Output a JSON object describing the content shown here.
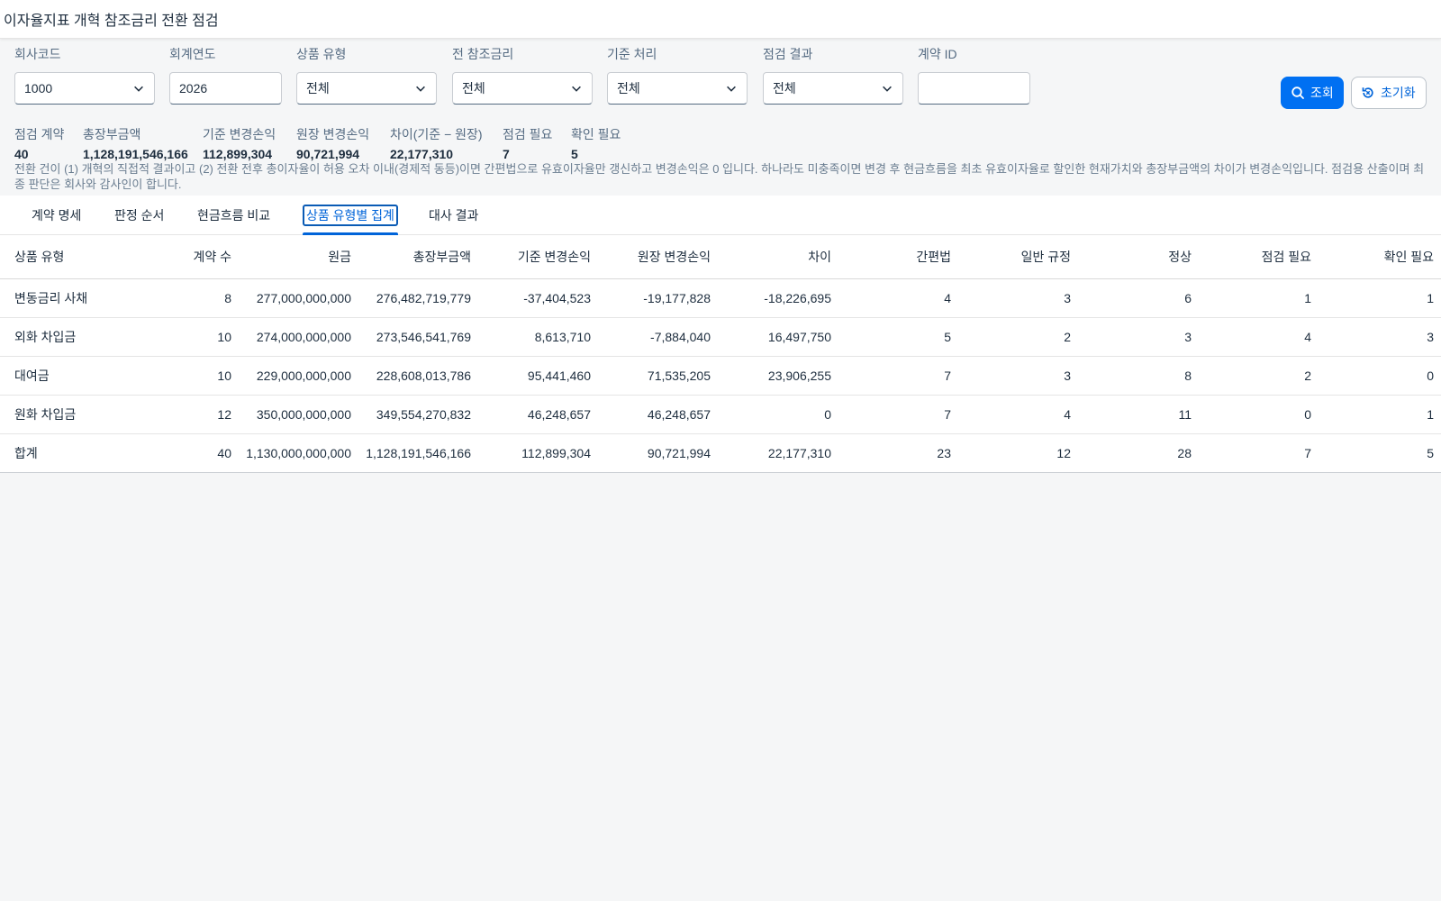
{
  "app": {
    "title": "이자율지표 개혁 참조금리 전환 점검"
  },
  "filters": {
    "company": {
      "label": "회사코드",
      "value": "1000"
    },
    "year": {
      "label": "회계연도",
      "value": "2026"
    },
    "product": {
      "label": "상품 유형",
      "value": "전체"
    },
    "prev_rate": {
      "label": "전 참조금리",
      "value": "전체"
    },
    "basis": {
      "label": "기준 처리",
      "value": "전체"
    },
    "result": {
      "label": "점검 결과",
      "value": "전체"
    },
    "contract_id": {
      "label": "계약 ID",
      "value": ""
    }
  },
  "buttons": {
    "search": "조회",
    "reset": "초기화"
  },
  "kpis": [
    {
      "label": "점검 계약",
      "value": "40"
    },
    {
      "label": "총장부금액",
      "value": "1,128,191,546,166"
    },
    {
      "label": "기준 변경손익",
      "value": "112,899,304"
    },
    {
      "label": "원장 변경손익",
      "value": "90,721,994"
    },
    {
      "label": "차이(기준 − 원장)",
      "value": "22,177,310"
    },
    {
      "label": "점검 필요",
      "value": "7"
    },
    {
      "label": "확인 필요",
      "value": "5"
    }
  ],
  "note": "전환 건이 (1) 개혁의 직접적 결과이고 (2) 전환 전후 총이자율이 허용 오차 이내(경제적 동등)이면 간편법으로 유효이자율만 갱신하고 변경손익은 0 입니다. 하나라도 미충족이면 변경 후 현금흐름을 최초 유효이자율로 할인한 현재가치와 총장부금액의 차이가 변경손익입니다. 점검용 산출이며 최종 판단은 회사와 감사인이 합니다.",
  "tabs": [
    {
      "label": "계약 명세",
      "active": false
    },
    {
      "label": "판정 순서",
      "active": false
    },
    {
      "label": "현금흐름 비교",
      "active": false
    },
    {
      "label": "상품 유형별 집계",
      "active": true
    },
    {
      "label": "대사 결과",
      "active": false
    }
  ],
  "table": {
    "headers": [
      "상품 유형",
      "계약 수",
      "원금",
      "총장부금액",
      "기준 변경손익",
      "원장 변경손익",
      "차이",
      "간편법",
      "일반 규정",
      "정상",
      "점검 필요",
      "확인 필요"
    ],
    "rows": [
      [
        "변동금리 사채",
        "8",
        "277,000,000,000",
        "276,482,719,779",
        "-37,404,523",
        "-19,177,828",
        "-18,226,695",
        "4",
        "3",
        "6",
        "1",
        "1"
      ],
      [
        "외화 차입금",
        "10",
        "274,000,000,000",
        "273,546,541,769",
        "8,613,710",
        "-7,884,040",
        "16,497,750",
        "5",
        "2",
        "3",
        "4",
        "3"
      ],
      [
        "대여금",
        "10",
        "229,000,000,000",
        "228,608,013,786",
        "95,441,460",
        "71,535,205",
        "23,906,255",
        "7",
        "3",
        "8",
        "2",
        "0"
      ],
      [
        "원화 차입금",
        "12",
        "350,000,000,000",
        "349,554,270,832",
        "46,248,657",
        "46,248,657",
        "0",
        "7",
        "4",
        "11",
        "0",
        "1"
      ],
      [
        "합계",
        "40",
        "1,130,000,000,000",
        "1,128,191,546,166",
        "112,899,304",
        "90,721,994",
        "22,177,310",
        "23",
        "12",
        "28",
        "7",
        "5"
      ]
    ]
  },
  "colors": {
    "accent": "#0070f2",
    "text": "#1d2d3e",
    "muted": "#556b82",
    "background": "#f5f6f7"
  },
  "icons": {
    "search": "search-icon",
    "reset": "reset-icon",
    "dropdown": "chevron-down-icon"
  }
}
